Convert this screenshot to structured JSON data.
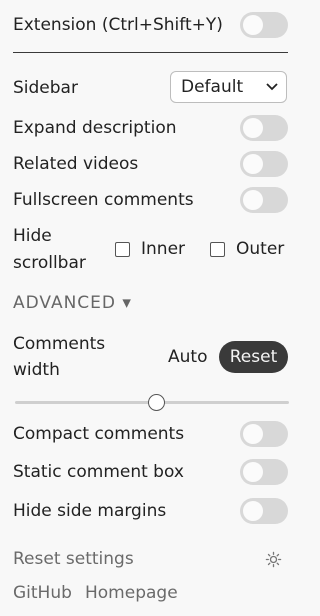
{
  "extension": {
    "label": "Extension (Ctrl+Shift+Y)",
    "enabled": false
  },
  "sidebar": {
    "label": "Sidebar",
    "selected": "Default"
  },
  "expand_description": {
    "label": "Expand description",
    "enabled": false
  },
  "related_videos": {
    "label": "Related videos",
    "enabled": false
  },
  "fullscreen_comments": {
    "label": "Fullscreen comments",
    "enabled": false
  },
  "hide_scrollbar": {
    "label_line1": "Hide",
    "label_line2": "scrollbar",
    "inner_label": "Inner",
    "outer_label": "Outer",
    "inner_checked": false,
    "outer_checked": false
  },
  "advanced": {
    "label": "ADVANCED ▾"
  },
  "comments_width": {
    "label_line1": "Comments",
    "label_line2": "width",
    "value": "Auto",
    "reset_label": "Reset",
    "slider_fraction": 0.5
  },
  "compact_comments": {
    "label": "Compact comments",
    "enabled": false
  },
  "static_comment_box": {
    "label": "Static comment box",
    "enabled": false
  },
  "hide_side_margins": {
    "label": "Hide side margins",
    "enabled": false
  },
  "footer": {
    "reset_settings": "Reset settings",
    "theme_icon": "sun-icon",
    "github": "GitHub",
    "homepage": "Homepage"
  },
  "colors": {
    "toggle_off": "#d8d8d8",
    "button_dark": "#3a3a3a",
    "background": "#f8f8f8"
  }
}
